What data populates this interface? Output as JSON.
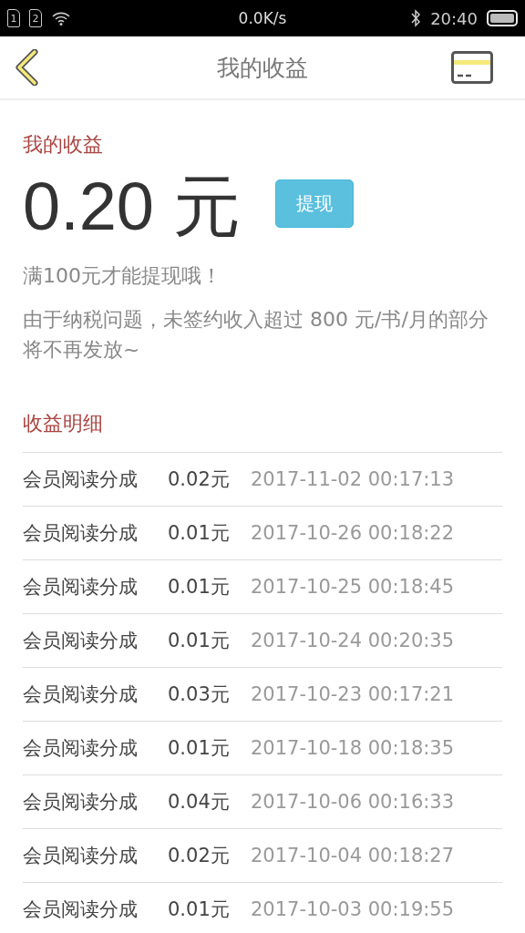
{
  "status_bar": {
    "sim_cards": [
      "1",
      "2"
    ],
    "speed": "0.0K/s",
    "time": "20:40"
  },
  "header": {
    "title": "我的收益"
  },
  "earnings": {
    "heading": "我的收益",
    "amount": "0.20 元",
    "withdraw_button": "提现",
    "note": "满100元才能提现哦！",
    "tax_notice": "由于纳税问题，未签约收入超过 800 元/书/月的部分将不再发放~"
  },
  "details": {
    "heading": "收益明细",
    "rows": [
      {
        "type": "会员阅读分成",
        "amount": "0.02元",
        "time": "2017-11-02 00:17:13"
      },
      {
        "type": "会员阅读分成",
        "amount": "0.01元",
        "time": "2017-10-26 00:18:22"
      },
      {
        "type": "会员阅读分成",
        "amount": "0.01元",
        "time": "2017-10-25 00:18:45"
      },
      {
        "type": "会员阅读分成",
        "amount": "0.01元",
        "time": "2017-10-24 00:20:35"
      },
      {
        "type": "会员阅读分成",
        "amount": "0.03元",
        "time": "2017-10-23 00:17:21"
      },
      {
        "type": "会员阅读分成",
        "amount": "0.01元",
        "time": "2017-10-18 00:18:35"
      },
      {
        "type": "会员阅读分成",
        "amount": "0.04元",
        "time": "2017-10-06 00:16:33"
      },
      {
        "type": "会员阅读分成",
        "amount": "0.02元",
        "time": "2017-10-04 00:18:27"
      },
      {
        "type": "会员阅读分成",
        "amount": "0.01元",
        "time": "2017-10-03 00:19:55"
      }
    ]
  }
}
